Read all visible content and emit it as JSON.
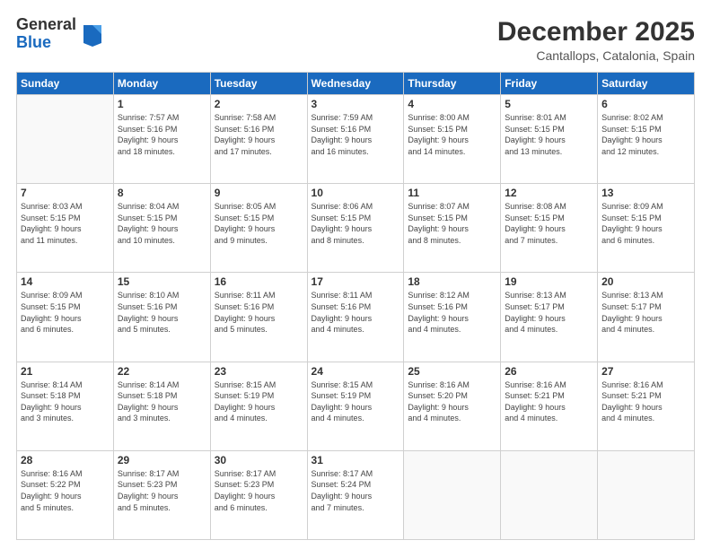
{
  "logo": {
    "general": "General",
    "blue": "Blue"
  },
  "title": "December 2025",
  "subtitle": "Cantallops, Catalonia, Spain",
  "days_header": [
    "Sunday",
    "Monday",
    "Tuesday",
    "Wednesday",
    "Thursday",
    "Friday",
    "Saturday"
  ],
  "weeks": [
    [
      {
        "num": "",
        "info": ""
      },
      {
        "num": "1",
        "info": "Sunrise: 7:57 AM\nSunset: 5:16 PM\nDaylight: 9 hours\nand 18 minutes."
      },
      {
        "num": "2",
        "info": "Sunrise: 7:58 AM\nSunset: 5:16 PM\nDaylight: 9 hours\nand 17 minutes."
      },
      {
        "num": "3",
        "info": "Sunrise: 7:59 AM\nSunset: 5:16 PM\nDaylight: 9 hours\nand 16 minutes."
      },
      {
        "num": "4",
        "info": "Sunrise: 8:00 AM\nSunset: 5:15 PM\nDaylight: 9 hours\nand 14 minutes."
      },
      {
        "num": "5",
        "info": "Sunrise: 8:01 AM\nSunset: 5:15 PM\nDaylight: 9 hours\nand 13 minutes."
      },
      {
        "num": "6",
        "info": "Sunrise: 8:02 AM\nSunset: 5:15 PM\nDaylight: 9 hours\nand 12 minutes."
      }
    ],
    [
      {
        "num": "7",
        "info": "Sunrise: 8:03 AM\nSunset: 5:15 PM\nDaylight: 9 hours\nand 11 minutes."
      },
      {
        "num": "8",
        "info": "Sunrise: 8:04 AM\nSunset: 5:15 PM\nDaylight: 9 hours\nand 10 minutes."
      },
      {
        "num": "9",
        "info": "Sunrise: 8:05 AM\nSunset: 5:15 PM\nDaylight: 9 hours\nand 9 minutes."
      },
      {
        "num": "10",
        "info": "Sunrise: 8:06 AM\nSunset: 5:15 PM\nDaylight: 9 hours\nand 8 minutes."
      },
      {
        "num": "11",
        "info": "Sunrise: 8:07 AM\nSunset: 5:15 PM\nDaylight: 9 hours\nand 8 minutes."
      },
      {
        "num": "12",
        "info": "Sunrise: 8:08 AM\nSunset: 5:15 PM\nDaylight: 9 hours\nand 7 minutes."
      },
      {
        "num": "13",
        "info": "Sunrise: 8:09 AM\nSunset: 5:15 PM\nDaylight: 9 hours\nand 6 minutes."
      }
    ],
    [
      {
        "num": "14",
        "info": "Sunrise: 8:09 AM\nSunset: 5:15 PM\nDaylight: 9 hours\nand 6 minutes."
      },
      {
        "num": "15",
        "info": "Sunrise: 8:10 AM\nSunset: 5:16 PM\nDaylight: 9 hours\nand 5 minutes."
      },
      {
        "num": "16",
        "info": "Sunrise: 8:11 AM\nSunset: 5:16 PM\nDaylight: 9 hours\nand 5 minutes."
      },
      {
        "num": "17",
        "info": "Sunrise: 8:11 AM\nSunset: 5:16 PM\nDaylight: 9 hours\nand 4 minutes."
      },
      {
        "num": "18",
        "info": "Sunrise: 8:12 AM\nSunset: 5:16 PM\nDaylight: 9 hours\nand 4 minutes."
      },
      {
        "num": "19",
        "info": "Sunrise: 8:13 AM\nSunset: 5:17 PM\nDaylight: 9 hours\nand 4 minutes."
      },
      {
        "num": "20",
        "info": "Sunrise: 8:13 AM\nSunset: 5:17 PM\nDaylight: 9 hours\nand 4 minutes."
      }
    ],
    [
      {
        "num": "21",
        "info": "Sunrise: 8:14 AM\nSunset: 5:18 PM\nDaylight: 9 hours\nand 3 minutes."
      },
      {
        "num": "22",
        "info": "Sunrise: 8:14 AM\nSunset: 5:18 PM\nDaylight: 9 hours\nand 3 minutes."
      },
      {
        "num": "23",
        "info": "Sunrise: 8:15 AM\nSunset: 5:19 PM\nDaylight: 9 hours\nand 4 minutes."
      },
      {
        "num": "24",
        "info": "Sunrise: 8:15 AM\nSunset: 5:19 PM\nDaylight: 9 hours\nand 4 minutes."
      },
      {
        "num": "25",
        "info": "Sunrise: 8:16 AM\nSunset: 5:20 PM\nDaylight: 9 hours\nand 4 minutes."
      },
      {
        "num": "26",
        "info": "Sunrise: 8:16 AM\nSunset: 5:21 PM\nDaylight: 9 hours\nand 4 minutes."
      },
      {
        "num": "27",
        "info": "Sunrise: 8:16 AM\nSunset: 5:21 PM\nDaylight: 9 hours\nand 4 minutes."
      }
    ],
    [
      {
        "num": "28",
        "info": "Sunrise: 8:16 AM\nSunset: 5:22 PM\nDaylight: 9 hours\nand 5 minutes."
      },
      {
        "num": "29",
        "info": "Sunrise: 8:17 AM\nSunset: 5:23 PM\nDaylight: 9 hours\nand 5 minutes."
      },
      {
        "num": "30",
        "info": "Sunrise: 8:17 AM\nSunset: 5:23 PM\nDaylight: 9 hours\nand 6 minutes."
      },
      {
        "num": "31",
        "info": "Sunrise: 8:17 AM\nSunset: 5:24 PM\nDaylight: 9 hours\nand 7 minutes."
      },
      {
        "num": "",
        "info": ""
      },
      {
        "num": "",
        "info": ""
      },
      {
        "num": "",
        "info": ""
      }
    ]
  ]
}
